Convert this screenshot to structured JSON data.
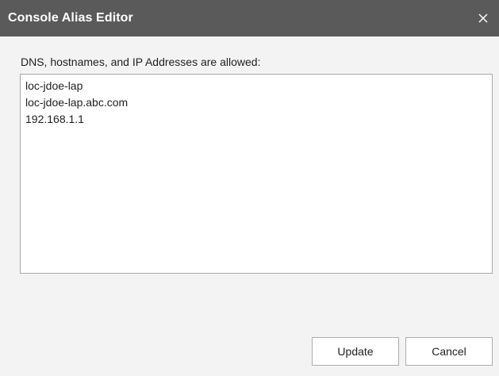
{
  "dialog": {
    "title": "Console Alias Editor",
    "close_icon": "close-icon",
    "instruction": "DNS, hostnames, and IP Addresses are allowed:",
    "aliases": [
      "loc-jdoe-lap",
      "loc-jdoe-lap.abc.com",
      "192.168.1.1"
    ],
    "buttons": {
      "update_label": "Update",
      "cancel_label": "Cancel"
    }
  },
  "colors": {
    "titlebar_bg": "#5a5a5a",
    "titlebar_text": "#ffffff",
    "dialog_bg": "#f3f3f3",
    "input_bg": "#ffffff",
    "border": "#a8a8a8"
  }
}
